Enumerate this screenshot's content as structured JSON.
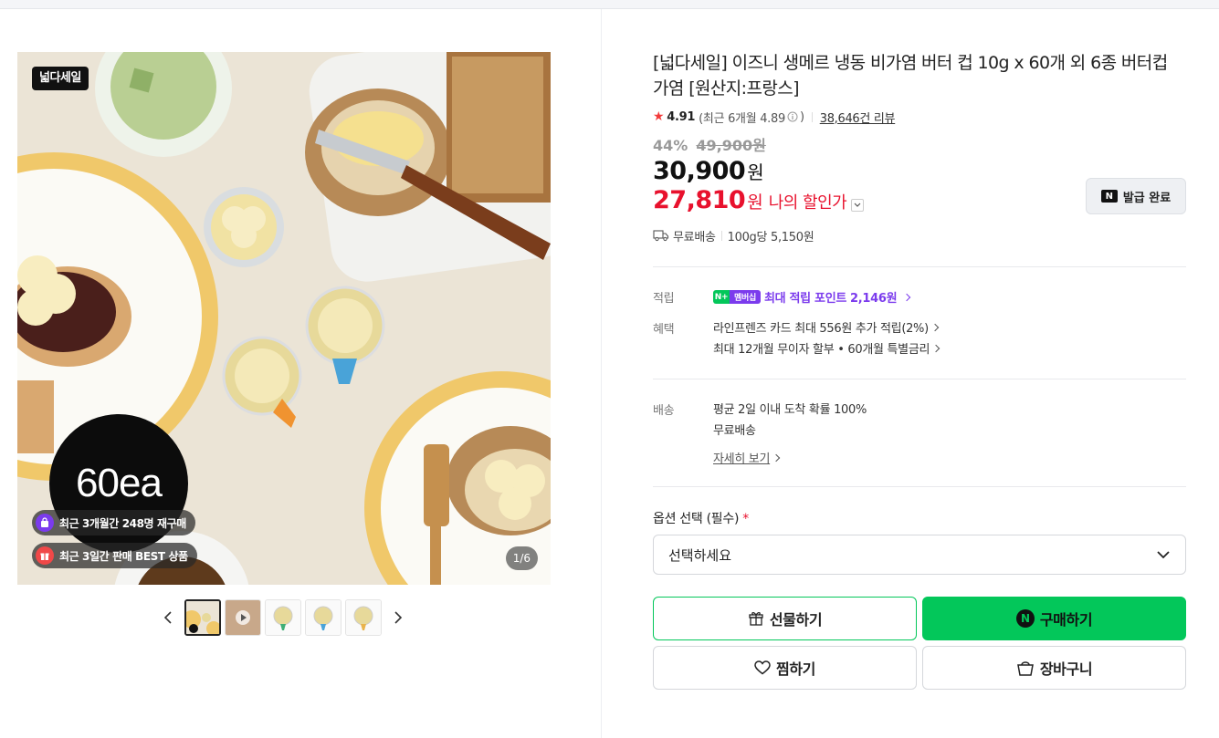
{
  "gallery": {
    "sale_badge": "넓다세일",
    "count_badge": "60ea",
    "repurchase_pill": "최근 3개월간 248명 재구매",
    "best_pill": "최근 3일간 판매 BEST 상품",
    "page_counter": "1/6",
    "thumbnail_count": 5
  },
  "product": {
    "title": "[넓다세일] 이즈니 생메르 냉동 비가염 버터 컵 10g x 60개 외 6종 버터컵 가염 [원산지:프랑스]",
    "rating": "4.91",
    "recent_rating": "(최근 6개월 4.89",
    "recent_rating_close": ")",
    "review_count": "38,646건 리뷰",
    "discount_rate": "44%",
    "original_price": "49,900원",
    "sale_price": "30,900",
    "won": "원",
    "my_price": "27,810",
    "my_price_label": "나의 할인가",
    "coupon_button": "발급 완료",
    "shipping": "무료배송",
    "unit_price": "100g당 5,150원"
  },
  "benefits": {
    "points_label": "적립",
    "membership_badge": "멤버십",
    "points_text": "최대 적립 포인트",
    "points_value": "2,146원",
    "benefit_label": "혜택",
    "benefit_1": "라인프렌즈 카드 최대 556원 추가 적립(2%)",
    "benefit_2": "최대 12개월 무이자 할부 • 60개월 특별금리"
  },
  "delivery": {
    "label": "배송",
    "line_1": "평균 2일 이내 도착 확률 100%",
    "line_2": "무료배송",
    "detail_link": "자세히 보기"
  },
  "options": {
    "label": "옵션 선택 (필수)",
    "required_mark": "*",
    "select_placeholder": "선택하세요"
  },
  "actions": {
    "gift": "선물하기",
    "buy": "구매하기",
    "wish": "찜하기",
    "cart": "장바구니"
  },
  "colors": {
    "naver_green": "#03c75a",
    "discount_red": "#e8112d",
    "membership_purple": "#7b3bed"
  }
}
